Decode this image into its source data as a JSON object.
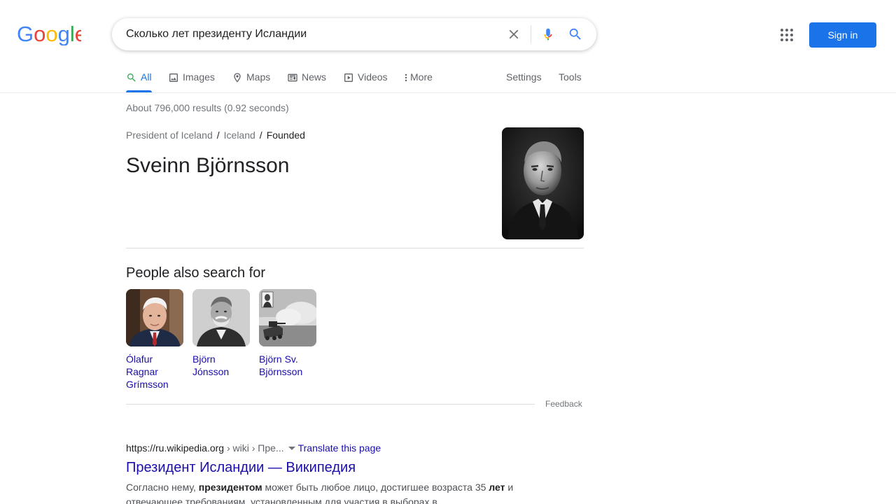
{
  "header": {
    "logo_text": "Google",
    "search_value": "Сколько лет президенту Исландии",
    "sign_in_label": "Sign in"
  },
  "tabs": [
    {
      "label": "All",
      "icon": "search-icon",
      "active": true
    },
    {
      "label": "Images",
      "icon": "image-icon"
    },
    {
      "label": "Maps",
      "icon": "map-pin-icon"
    },
    {
      "label": "News",
      "icon": "newspaper-icon"
    },
    {
      "label": "Videos",
      "icon": "play-icon"
    },
    {
      "label": "More",
      "icon": "more-vert-icon"
    }
  ],
  "tools": {
    "settings": "Settings",
    "tools": "Tools"
  },
  "stats": "About 796,000 results (0.92 seconds)",
  "knowledge": {
    "breadcrumb": [
      "President of Iceland",
      "Iceland",
      "Founded"
    ],
    "separator": "/",
    "answer": "Sveinn Björnsson"
  },
  "people_also_search": {
    "title": "People also search for",
    "people": [
      {
        "name": "Ólafur Ragnar Grímsson"
      },
      {
        "name": "Björn Jónsson"
      },
      {
        "name": "Björn Sv. Björnsson"
      }
    ]
  },
  "feedback": "Feedback",
  "result": {
    "url_domain": "https://ru.wikipedia.org",
    "url_path": " › wiki › Пре...",
    "translate": "Translate this page",
    "title": "Президент Исландии — Википедия",
    "snippet_1": "Согласно нему, ",
    "snippet_b1": "президентом",
    "snippet_2": " может быть любое лицо, достигшее возраста 35 ",
    "snippet_b2": "лет",
    "snippet_3": " и отвечающее требованиям, установленным для участия в выборах в"
  },
  "colors": {
    "accent": "#1a73e8",
    "link": "#1a0dab"
  }
}
